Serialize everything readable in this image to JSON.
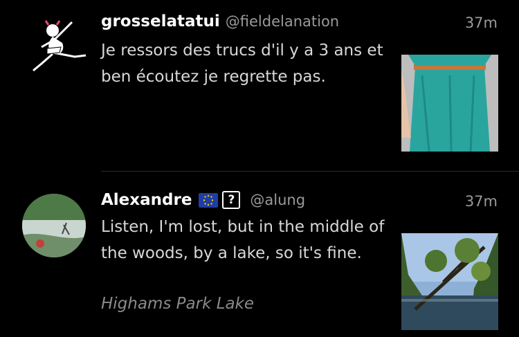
{
  "tweets": [
    {
      "name": "grosselatatui",
      "handle": "@fieldelanation",
      "time": "37m",
      "text": "Je ressors des trucs d'il y a 3 ans et ben écoutez je regrette pas."
    },
    {
      "name": "Alexandre",
      "handle": "@alung",
      "time": "37m",
      "text": "Listen, I'm lost, but in the middle of the woods, by a lake, so it's fine.",
      "place": "Highams Park Lake",
      "badge": "?"
    }
  ],
  "colors": {
    "background": "#000000",
    "handle": "#9a9a9a",
    "body_text": "#d8d8d8",
    "place": "#8a8a8a",
    "eu_flag": "#1f3da5"
  }
}
